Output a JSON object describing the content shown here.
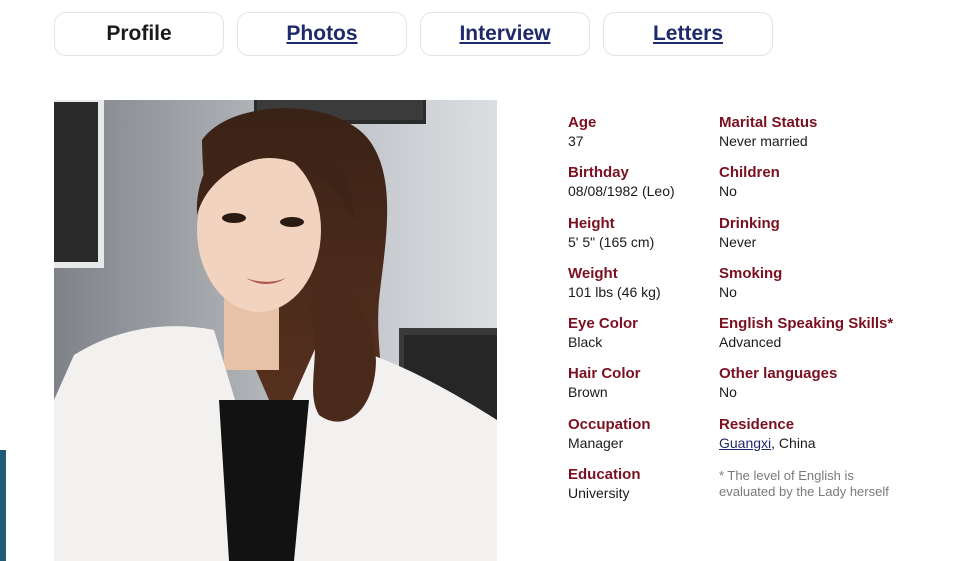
{
  "tabs": [
    {
      "label": "Profile"
    },
    {
      "label": "Photos"
    },
    {
      "label": "Interview"
    },
    {
      "label": "Letters"
    }
  ],
  "profile": {
    "left_fields": [
      {
        "label": "Age",
        "value": "37"
      },
      {
        "label": "Birthday",
        "value": "08/08/1982 (Leo)"
      },
      {
        "label": "Height",
        "value": "5' 5\" (165 cm)"
      },
      {
        "label": "Weight",
        "value": "101 lbs (46 kg)"
      },
      {
        "label": "Eye Color",
        "value": "Black"
      },
      {
        "label": "Hair Color",
        "value": "Brown"
      },
      {
        "label": "Occupation",
        "value": "Manager"
      },
      {
        "label": "Education",
        "value": "University"
      }
    ],
    "right_fields": [
      {
        "label": "Marital Status",
        "value": "Never married"
      },
      {
        "label": "Children",
        "value": "No"
      },
      {
        "label": "Drinking",
        "value": "Never"
      },
      {
        "label": "Smoking",
        "value": "No"
      },
      {
        "label": "English Speaking Skills*",
        "value": "Advanced"
      },
      {
        "label": "Other languages",
        "value": "No"
      }
    ],
    "residence": {
      "label": "Residence",
      "city": "Guangxi",
      "country_suffix": ", China"
    },
    "footnote": "* The level of English is evaluated by the Lady herself"
  },
  "colors": {
    "label": "#7a1020",
    "link": "#1e2a6b",
    "note": "#7a7a7a",
    "side_bar": "#1f5a77"
  }
}
